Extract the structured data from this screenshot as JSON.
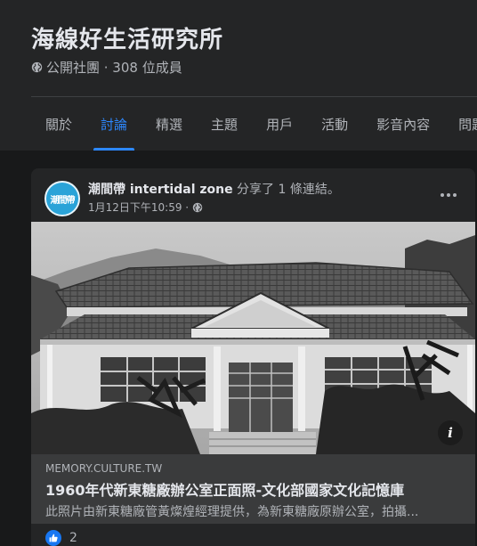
{
  "group": {
    "name": "海線好生活研究所",
    "meta": "公開社團 · 308 位成員"
  },
  "tabs": [
    {
      "label": "關於"
    },
    {
      "label": "討論"
    },
    {
      "label": "精選"
    },
    {
      "label": "主題"
    },
    {
      "label": "用戶"
    },
    {
      "label": "活動"
    },
    {
      "label": "影音內容"
    },
    {
      "label": "問題"
    }
  ],
  "active_tab": "討論",
  "post": {
    "avatar_text": "潮間帶",
    "author": "潮間帶 intertidal zone",
    "action": " 分享了 1 條連結。",
    "time": "1月12日下午10:59 ·",
    "link": {
      "domain": "MEMORY.CULTURE.TW",
      "title": "1960年代新東糖廠辦公室正面照-文化部國家文化記憶庫",
      "description": "此照片由新東糖廠管黃燦煌經理提供，為新東糖廠原辦公室，拍攝..."
    },
    "reaction_count": "2"
  },
  "colors": {
    "accent": "#2d88ff",
    "background": "#18191a",
    "surface": "#242526",
    "link_box": "#3a3b3c"
  },
  "icons": [
    "globe-icon",
    "more-icon",
    "info-icon",
    "like-icon"
  ]
}
